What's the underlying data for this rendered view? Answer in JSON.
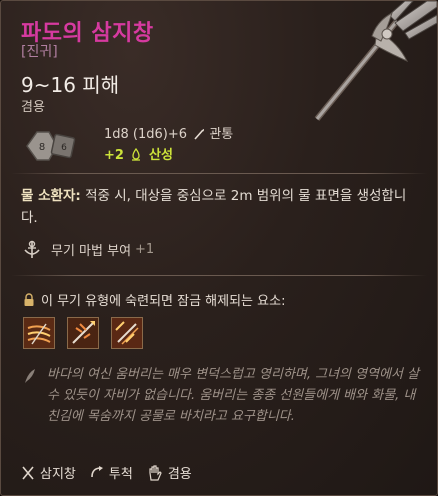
{
  "item": {
    "name": "파도의 삼지창",
    "rarity": "[진귀]",
    "damage": "9~16 피해",
    "handedness": "겸용"
  },
  "stats": {
    "dice_text": "1d8 (1d6)+6",
    "damage_type": "관통",
    "bonus_prefix": "+2",
    "bonus_type": "산성"
  },
  "ability": {
    "name": "물 소환자:",
    "text": " 적중 시, 대상을 중심으로 2m 범위의 물 표면을 생성합니다."
  },
  "enchant": {
    "label": "무기 마법 부여",
    "value": "+1"
  },
  "mastery": {
    "label": "이 무기 유형에 숙련되면 잠금 해제되는 요소:"
  },
  "lore": "바다의 여신 움버리는 매우 변덕스럽고 영리하며, 그녀의 영역에서 살 수 있듯이 자비가 없습니다. 움버리는 종종 선원들에게 배와 화물, 내친김에 목숨까지 공물로 바치라고 요구합니다.",
  "footer": {
    "weapon_type": "삼지창",
    "thrown": "투척",
    "handed": "겸용"
  },
  "icons": [
    "trident-icon",
    "dice-icon",
    "pierce-icon",
    "acid-icon",
    "enchant-icon",
    "lock-icon",
    "weapon-action-icon",
    "quill-icon",
    "trident-type-icon",
    "thrown-icon",
    "hand-icon"
  ],
  "colors": {
    "title": "#d63aa0",
    "acid": "#cce23a",
    "background": "#2a201c"
  }
}
